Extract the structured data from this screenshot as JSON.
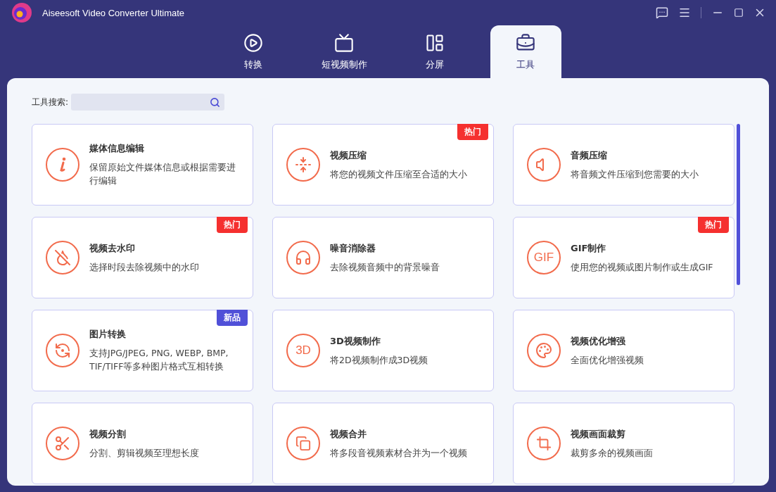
{
  "window": {
    "title": "Aiseesoft Video Converter Ultimate"
  },
  "tabs": [
    {
      "label": "转换",
      "selected": false
    },
    {
      "label": "短视频制作",
      "selected": false
    },
    {
      "label": "分屏",
      "selected": false
    },
    {
      "label": "工具",
      "selected": true
    }
  ],
  "search": {
    "label": "工具搜索:"
  },
  "tools": [
    {
      "title": "媒体信息编辑",
      "description": "保留原始文件媒体信息或根据需要进行编辑"
    },
    {
      "title": "视频压缩",
      "description": "将您的视频文件压缩至合适的大小",
      "badge": {
        "text": "热门",
        "kind": "hot"
      }
    },
    {
      "title": "音频压缩",
      "description": "将音频文件压缩到您需要的大小"
    },
    {
      "title": "视频去水印",
      "description": "选择时段去除视频中的水印",
      "badge": {
        "text": "热门",
        "kind": "hot"
      }
    },
    {
      "title": "噪音消除器",
      "description": "去除视频音频中的背景噪音"
    },
    {
      "title": "GIF制作",
      "description": "使用您的视频或图片制作或生成GIF",
      "badge": {
        "text": "热门",
        "kind": "hot"
      },
      "icon_text": "GIF"
    },
    {
      "title": "图片转换",
      "description": "支持JPG/JPEG, PNG, WEBP, BMP, TIF/TIFF等多种图片格式互相转换",
      "badge": {
        "text": "新品",
        "kind": "new"
      }
    },
    {
      "title": "3D视频制作",
      "description": "将2D视频制作成3D视频",
      "icon_text": "3D"
    },
    {
      "title": "视频优化增强",
      "description": "全面优化增强视频"
    },
    {
      "title": "视频分割",
      "description": "分割、剪辑视频至理想长度"
    },
    {
      "title": "视频合并",
      "description": "将多段音视频素材合并为一个视频"
    },
    {
      "title": "视频画面裁剪",
      "description": "裁剪多余的视频画面"
    }
  ]
}
